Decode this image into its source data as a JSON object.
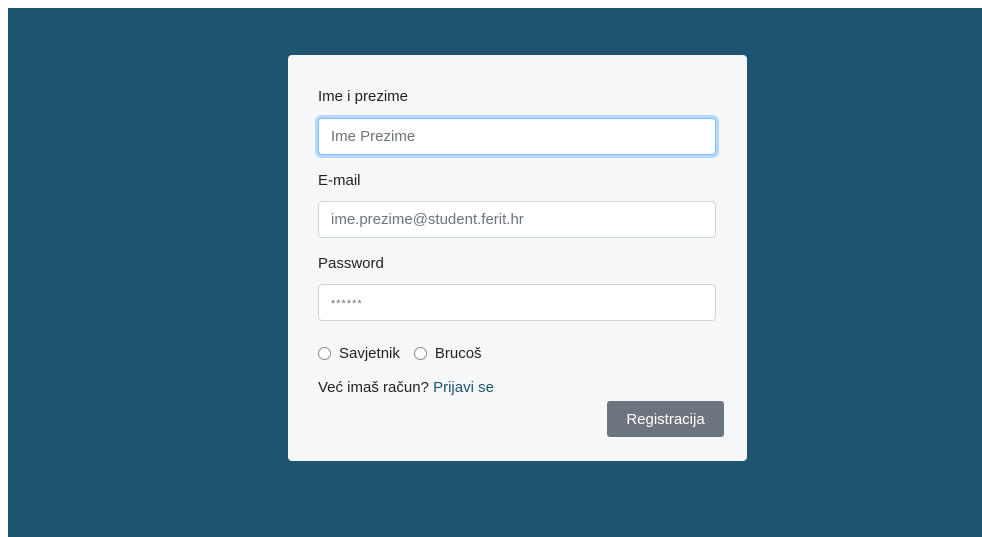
{
  "colors": {
    "background": "#1d5470",
    "card": "#f5f7f9",
    "button": "#6c757d",
    "link": "#1d5470",
    "focus_border": "#80bdff"
  },
  "form": {
    "name_label": "Ime i prezime",
    "name_placeholder": "Ime Prezime",
    "name_value": "",
    "email_label": "E-mail",
    "email_placeholder": "ime.prezime@student.ferit.hr",
    "email_value": "",
    "password_label": "Password",
    "password_placeholder": "******",
    "password_value": "",
    "role_options": [
      "Savjetnik",
      "Brucoš"
    ],
    "selected_role": null,
    "login_prompt": "Već imaš račun?",
    "login_link": "Prijavi se",
    "submit_label": "Registracija"
  }
}
